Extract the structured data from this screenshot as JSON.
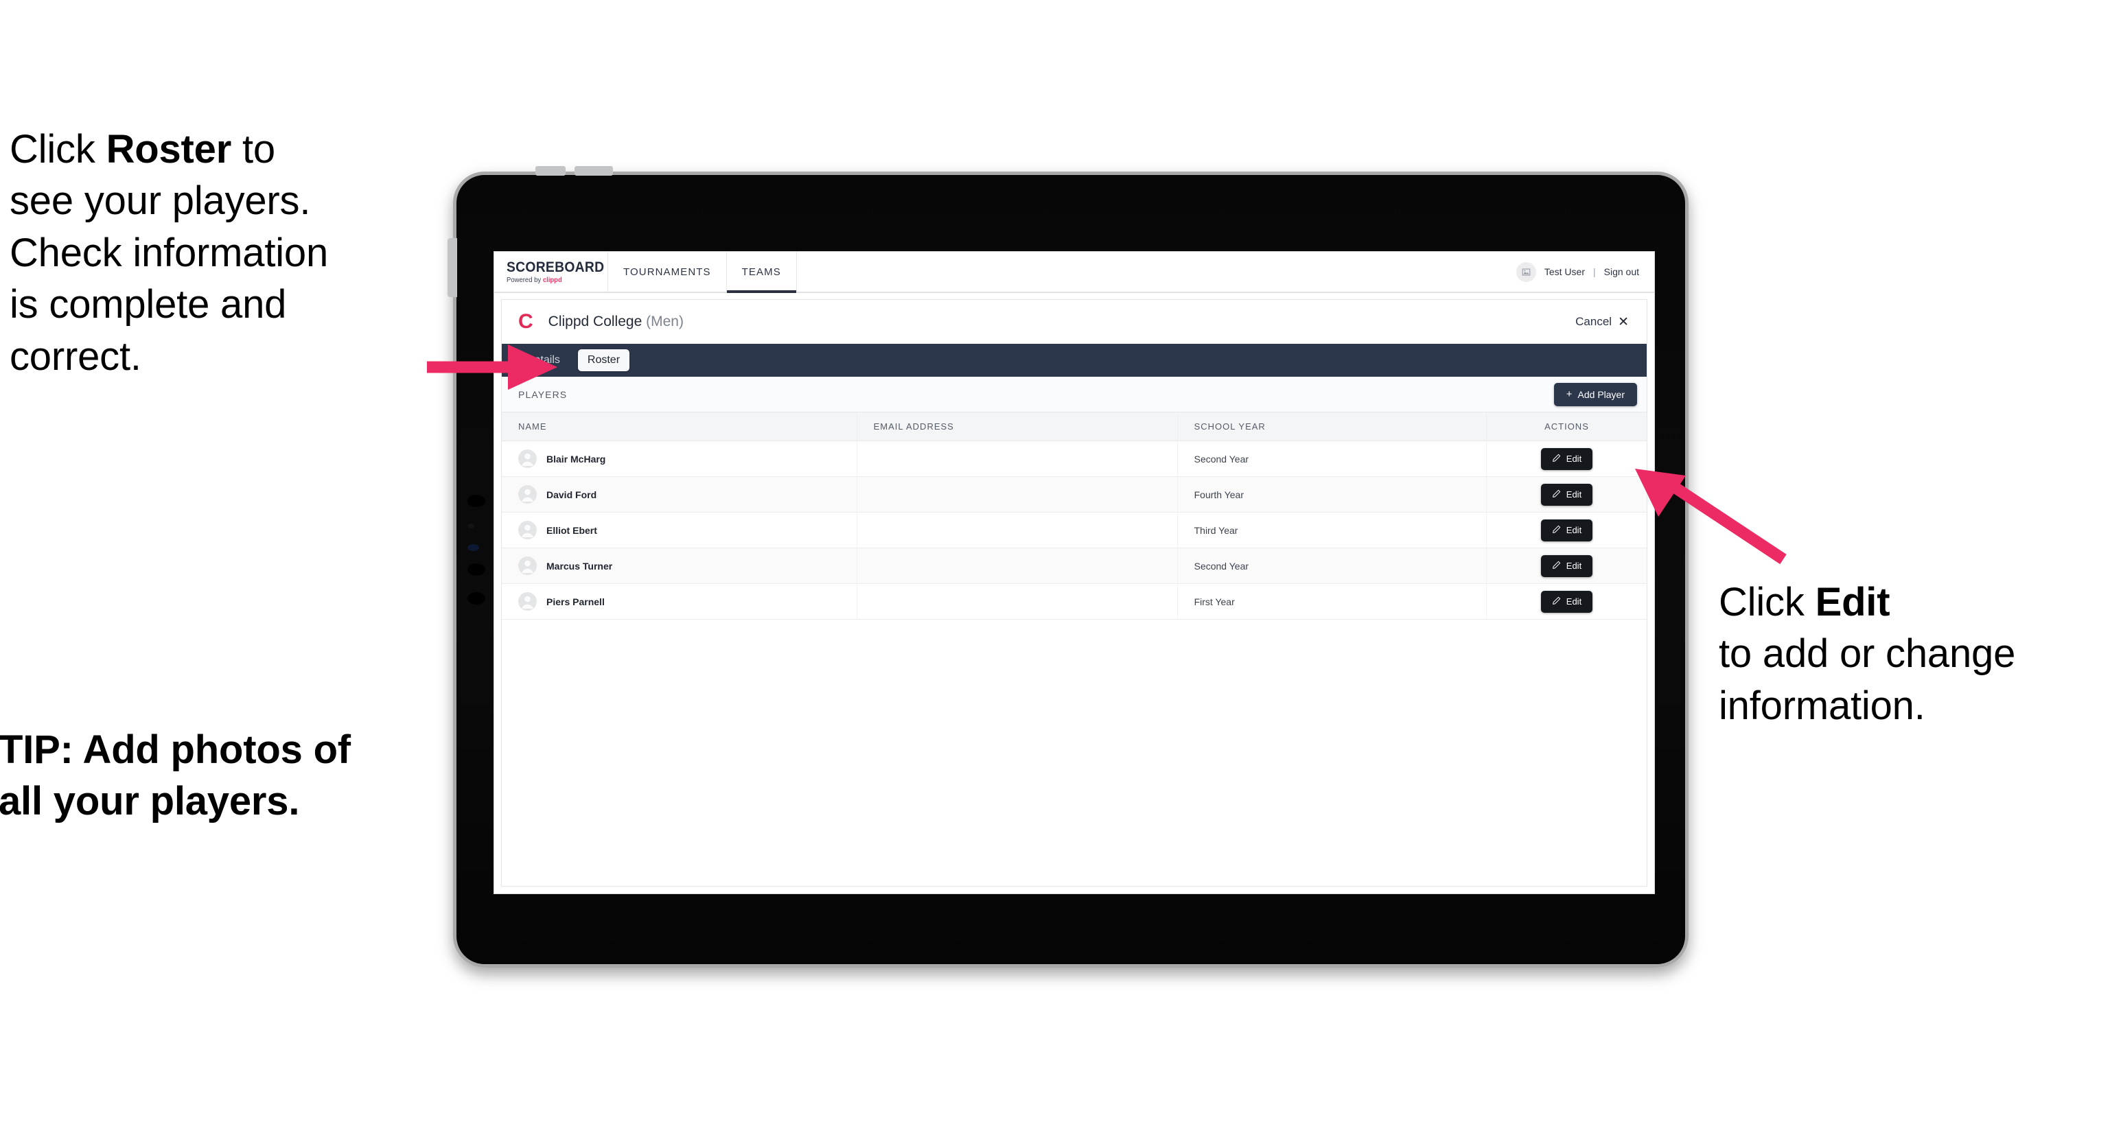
{
  "annotations": {
    "left_top": {
      "line1_a": "Click ",
      "line1_b": "Roster",
      "line1_c": " to",
      "line2": "see your players.",
      "line3": "Check information",
      "line4": "is complete and",
      "line5": "correct."
    },
    "left_bottom": {
      "line1": "TIP: Add photos of",
      "line2": "all your players."
    },
    "right": {
      "line1_a": "Click ",
      "line1_b": "Edit",
      "line2": "to add or change",
      "line3": "information."
    }
  },
  "colors": {
    "accent_pink": "#ee3a6b",
    "arrow_pink": "#ec2a63",
    "navy": "#2c374b",
    "button_black": "#15181d",
    "clippd_red": "#e02a55"
  },
  "app": {
    "brand": {
      "name": "SCOREBOARD",
      "powered_prefix": "Powered by ",
      "powered_brand": "clippd"
    },
    "nav_tabs": [
      {
        "label": "TOURNAMENTS",
        "active": false
      },
      {
        "label": "TEAMS",
        "active": true
      }
    ],
    "user": {
      "avatar_icon": "image-placeholder-icon",
      "name": "Test User",
      "divider": "|",
      "sign_out": "Sign out"
    },
    "card": {
      "team_logo_letter": "C",
      "team_name": "Clippd College",
      "team_gender": "(Men)",
      "cancel_label": "Cancel",
      "cancel_icon": "close-x-icon",
      "sub_tabs": [
        {
          "label": "Details",
          "active": false
        },
        {
          "label": "Roster",
          "active": true
        }
      ],
      "section_label": "PLAYERS",
      "add_player_label": "Add Player",
      "add_player_icon": "plus-icon",
      "table": {
        "columns": [
          "NAME",
          "EMAIL ADDRESS",
          "SCHOOL YEAR",
          "ACTIONS"
        ],
        "row_action_label": "Edit",
        "row_action_icon": "pencil-icon",
        "rows": [
          {
            "name": "Blair McHarg",
            "email": "",
            "school_year": "Second Year"
          },
          {
            "name": "David Ford",
            "email": "",
            "school_year": "Fourth Year"
          },
          {
            "name": "Elliot Ebert",
            "email": "",
            "school_year": "Third Year"
          },
          {
            "name": "Marcus Turner",
            "email": "",
            "school_year": "Second Year"
          },
          {
            "name": "Piers Parnell",
            "email": "",
            "school_year": "First Year"
          }
        ]
      }
    }
  }
}
